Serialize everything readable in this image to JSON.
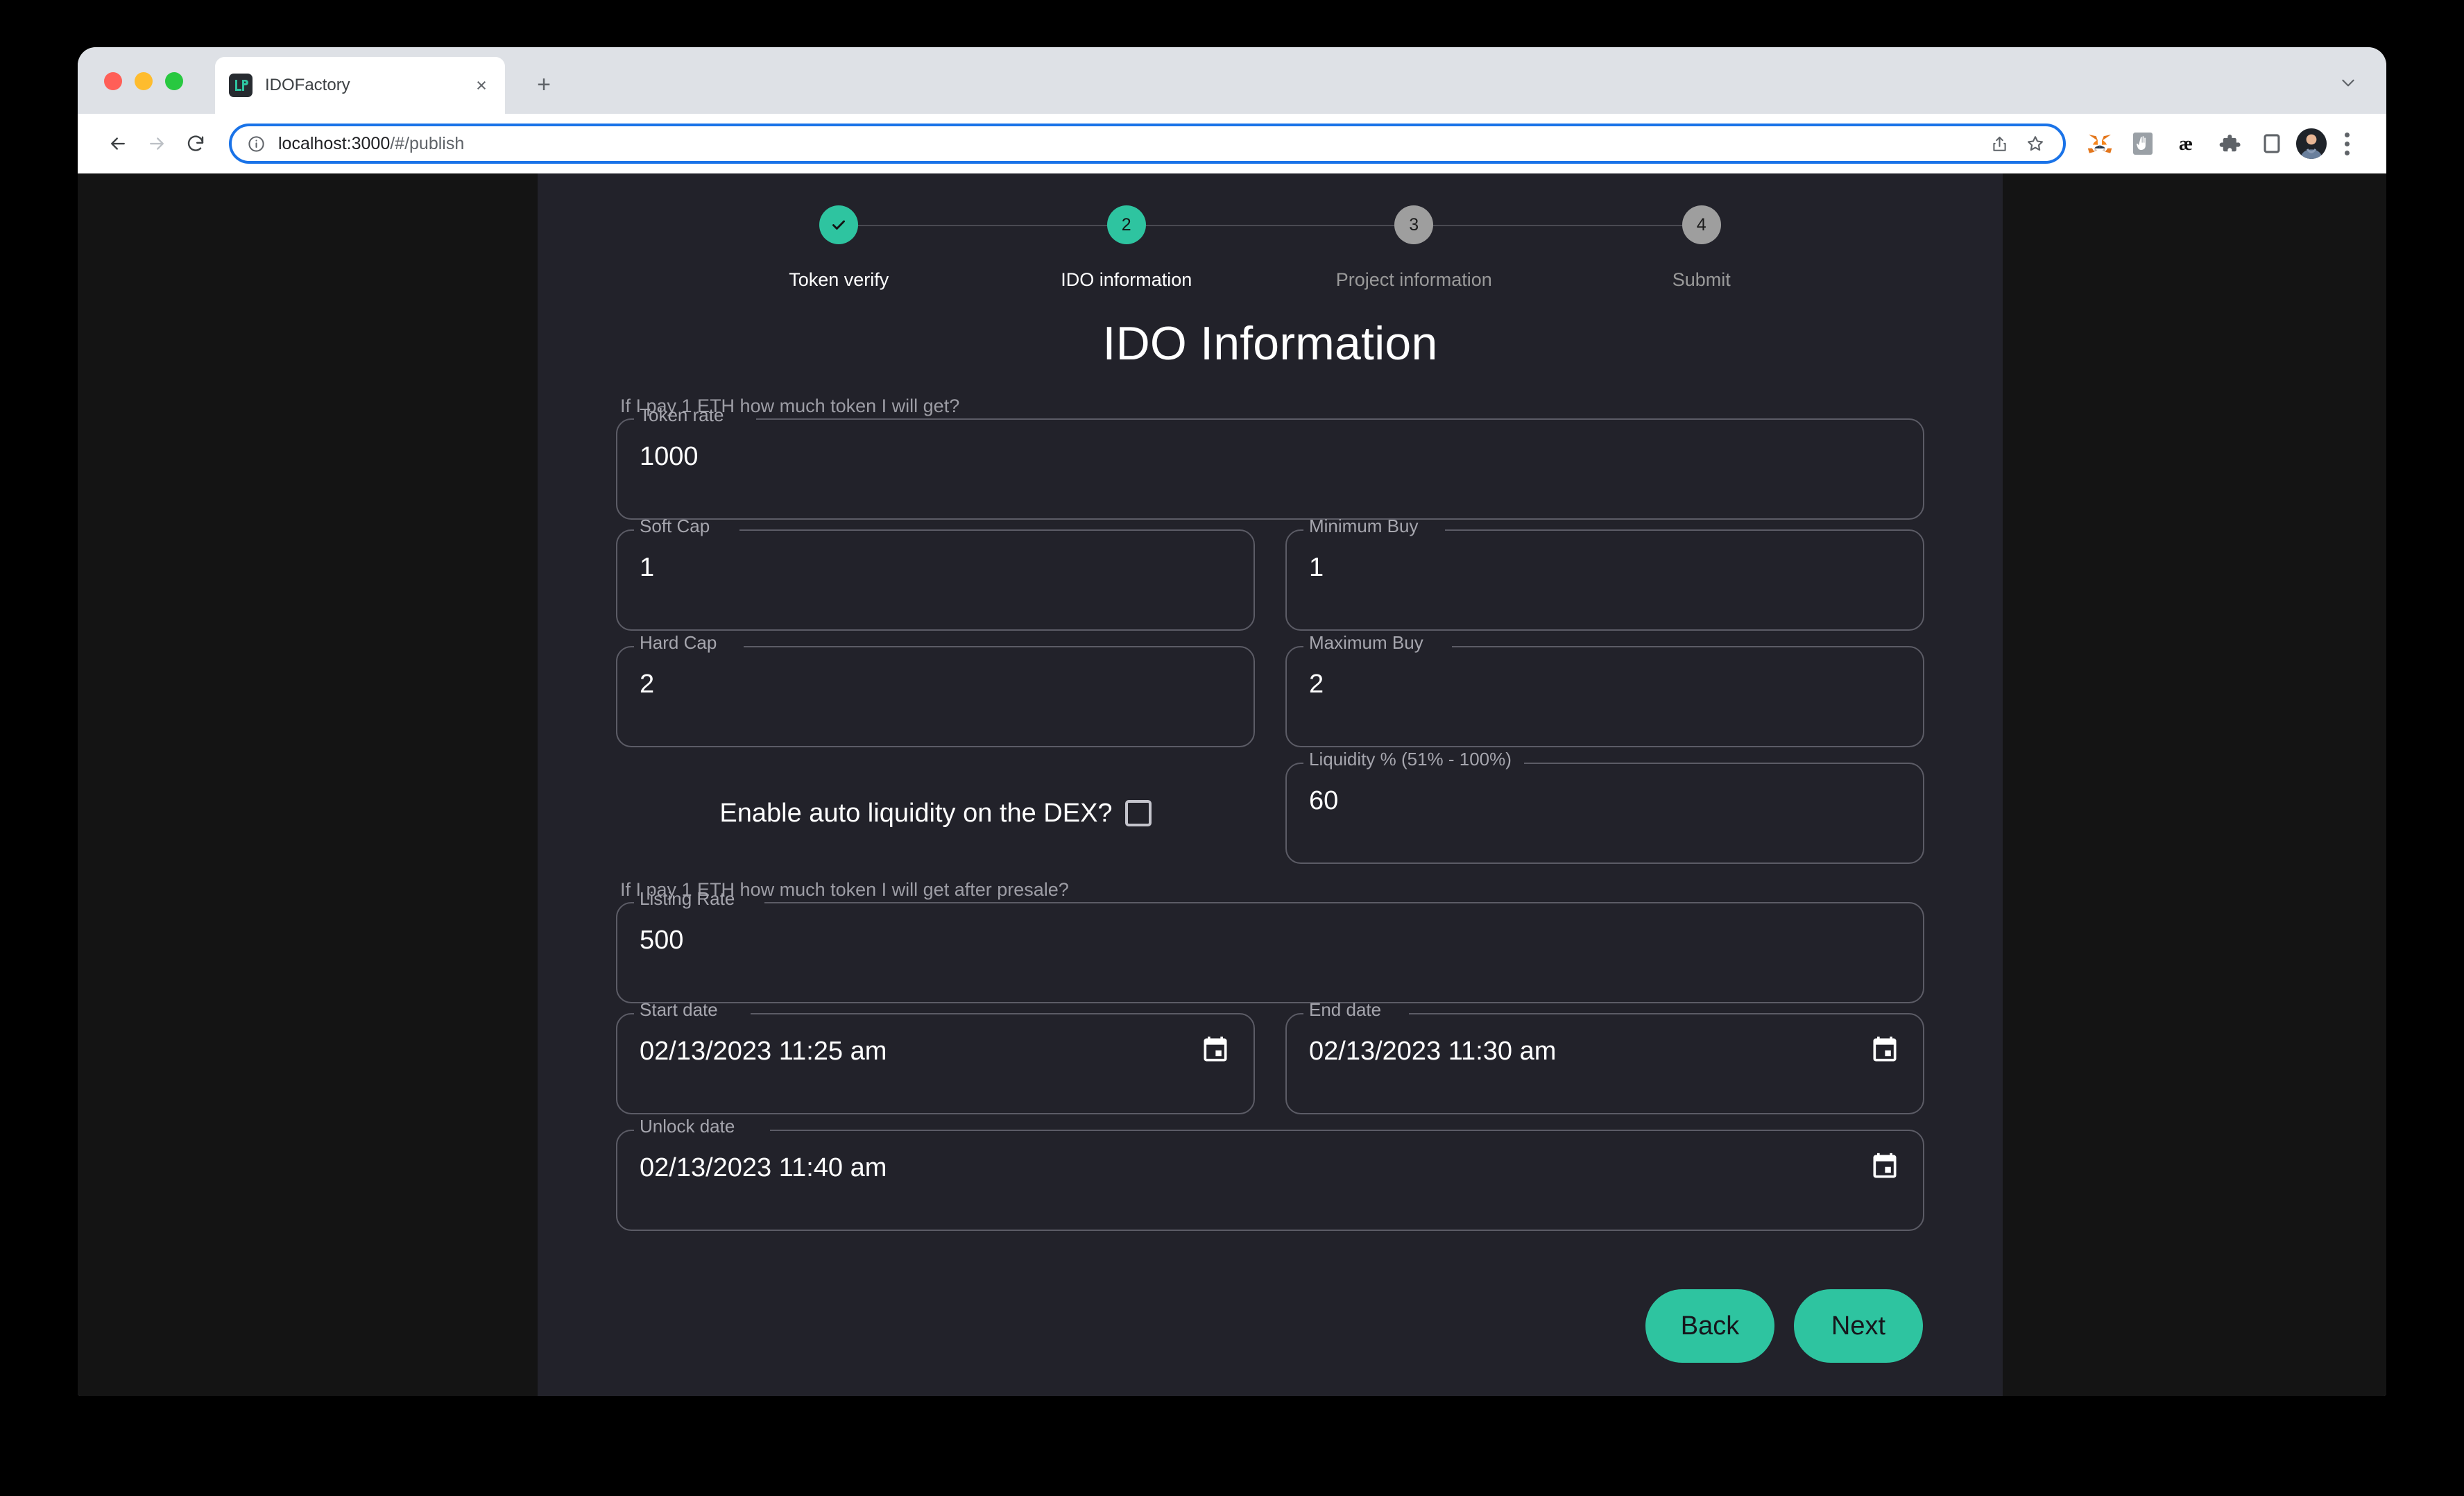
{
  "browser": {
    "tab": {
      "title": "IDOFactory",
      "favicon": "lp-monogram-icon",
      "close": "×"
    },
    "new_tab": "+",
    "toolbar": {
      "back": "back-arrow-icon",
      "forward": "forward-arrow-icon",
      "reload": "reload-icon",
      "site_info": "info-circle-icon",
      "url_host": "localhost:3000",
      "url_path": "/#/publish",
      "share": "share-icon",
      "bookmark": "star-icon",
      "extensions": [
        "metamask-fox-icon",
        "gesture-hand-icon",
        "ae-letter-icon",
        "puzzle-piece-icon",
        "side-panel-icon"
      ],
      "avatar": "user-avatar",
      "menu": "three-dot-menu-icon"
    }
  },
  "stepper": {
    "steps": [
      {
        "marker": "✓",
        "label": "Token verify",
        "state": "done"
      },
      {
        "marker": "2",
        "label": "IDO information",
        "state": "active"
      },
      {
        "marker": "3",
        "label": "Project information",
        "state": "todo"
      },
      {
        "marker": "4",
        "label": "Submit",
        "state": "todo"
      }
    ]
  },
  "page": {
    "title": "IDO Information",
    "helper_rate": "If I pay 1 ETH how much token I will get?",
    "helper_listing": "If I pay 1 ETH how much token I will get after presale?"
  },
  "fields": {
    "token_rate": {
      "label": "Token rate",
      "value": "1000"
    },
    "soft_cap": {
      "label": "Soft Cap",
      "value": "1"
    },
    "minimum_buy": {
      "label": "Minimum Buy",
      "value": "1"
    },
    "hard_cap": {
      "label": "Hard Cap",
      "value": "2"
    },
    "maximum_buy": {
      "label": "Maximum Buy",
      "value": "2"
    },
    "liquidity": {
      "label": "Liquidity % (51% - 100%)",
      "value": "60"
    },
    "listing_rate": {
      "label": "Listing Rate",
      "value": "500"
    },
    "start_date": {
      "label": "Start date",
      "value": "02/13/2023 11:25 am",
      "icon": "calendar-icon"
    },
    "end_date": {
      "label": "End date",
      "value": "02/13/2023 11:30 am",
      "icon": "calendar-icon"
    },
    "unlock_date": {
      "label": "Unlock date",
      "value": "02/13/2023 11:40 am",
      "icon": "calendar-icon"
    }
  },
  "auto_liquidity": {
    "label": "Enable auto liquidity on the DEX?",
    "checked": false
  },
  "actions": {
    "back": "Back",
    "next": "Next"
  },
  "colors": {
    "accent_green": "#2ec4a0",
    "panel_bg": "#22222a",
    "app_bg": "#141414",
    "outline": "#5c5c66",
    "label_gray": "#a6a6ae",
    "step_todo": "#9e9e9e"
  }
}
